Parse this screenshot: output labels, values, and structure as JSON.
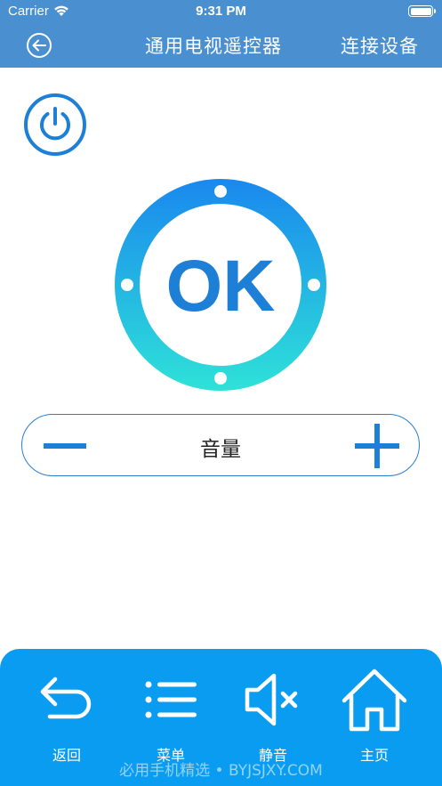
{
  "status_bar": {
    "carrier": "Carrier",
    "time": "9:31 PM"
  },
  "nav_bar": {
    "title": "通用电视遥控器",
    "connect_label": "连接设备"
  },
  "dial": {
    "center_label": "OK"
  },
  "volume": {
    "label": "音量"
  },
  "bottom_nav": {
    "items": [
      {
        "label": "返回",
        "icon": "back-arrow-icon"
      },
      {
        "label": "菜单",
        "icon": "menu-list-icon"
      },
      {
        "label": "静音",
        "icon": "mute-speaker-icon"
      },
      {
        "label": "主页",
        "icon": "home-icon"
      }
    ]
  },
  "watermark": "必用手机精选 • BYJSJXY.COM",
  "colors": {
    "header": "#4a8fd0",
    "accent": "#1e7fd6",
    "panel": "#0a9cf0",
    "ring_top": "#1a88ee",
    "ring_bottom": "#2ee2d8"
  }
}
